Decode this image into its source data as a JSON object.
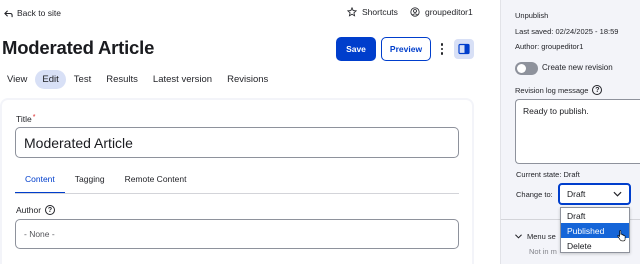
{
  "topbar": {
    "back_label": "Back to site",
    "shortcuts_label": "Shortcuts",
    "user_label": "groupeditor1"
  },
  "page": {
    "title": "Moderated Article",
    "save_label": "Save",
    "preview_label": "Preview"
  },
  "tabs": [
    {
      "label": "View",
      "active": false
    },
    {
      "label": "Edit",
      "active": true
    },
    {
      "label": "Test",
      "active": false
    },
    {
      "label": "Results",
      "active": false
    },
    {
      "label": "Latest version",
      "active": false
    },
    {
      "label": "Revisions",
      "active": false
    }
  ],
  "form": {
    "title_label": "Title",
    "title_required_mark": "*",
    "title_value": "Moderated Article",
    "subtabs": [
      {
        "label": "Content",
        "active": true
      },
      {
        "label": "Tagging",
        "active": false
      },
      {
        "label": "Remote Content",
        "active": false
      }
    ],
    "author_label": "Author",
    "author_value": "- None -",
    "help_glyph": "?"
  },
  "sidebar": {
    "status": "Unpublish",
    "last_saved": "Last saved: 02/24/2025 - 18:59",
    "author": "Author: groupeditor1",
    "create_revision_label": "Create new revision",
    "create_revision_on": false,
    "revision_log_label": "Revision log message",
    "revision_log_value": "Ready to publish.",
    "current_state": "Current state: Draft",
    "change_to_label": "Change to:",
    "change_to_value": "Draft",
    "options": [
      {
        "label": "Draft",
        "selected": false
      },
      {
        "label": "Published",
        "selected": true
      },
      {
        "label": "Delete",
        "selected": false
      }
    ],
    "menu_settings_label": "Menu se",
    "menu_settings_sub": "Not in m"
  },
  "colors": {
    "accent": "#003ecc",
    "active_tab_bg": "#d8e0f6",
    "selected_option": "#1565d8",
    "sidebar_bg": "#f3f4f9"
  },
  "icons": [
    "back-arrow-icon",
    "star-icon",
    "user-icon",
    "kebab-icon",
    "sidebar-toggle-icon",
    "help-icon",
    "chevron-down-icon",
    "pointer-cursor-icon"
  ]
}
